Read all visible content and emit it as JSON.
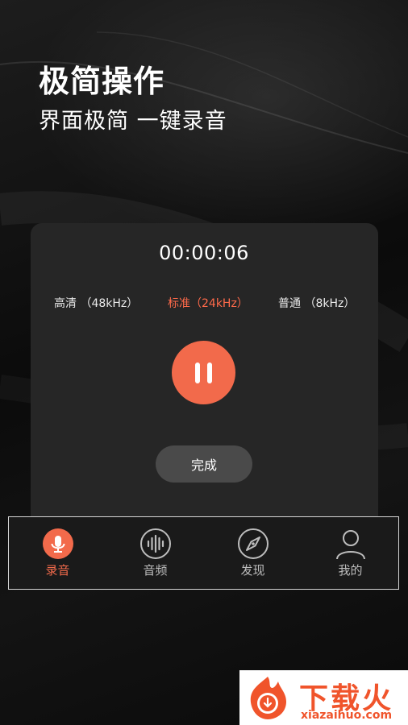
{
  "promo": {
    "title": "极简操作",
    "subtitle": "界面极简 一键录音"
  },
  "recorder": {
    "timer": "00:00:06",
    "quality_options": [
      {
        "label": "高清 （48kHz）",
        "selected": false
      },
      {
        "label": "标准（24kHz）",
        "selected": true
      },
      {
        "label": "普通 （8kHz）",
        "selected": false
      }
    ],
    "pause_icon": "pause-icon",
    "done_label": "完成"
  },
  "tabs": [
    {
      "label": "录音",
      "icon": "microphone-icon",
      "active": true
    },
    {
      "label": "音频",
      "icon": "waveform-icon",
      "active": false
    },
    {
      "label": "发现",
      "icon": "compass-icon",
      "active": false
    },
    {
      "label": "我的",
      "icon": "user-icon",
      "active": false
    }
  ],
  "watermark": {
    "brand": "下载火",
    "domain": "xiazaihuo.com"
  },
  "colors": {
    "accent": "#f26a4b",
    "card": "#262626",
    "background": "#0f0f0f",
    "tab_inactive": "#bdbdbd"
  }
}
